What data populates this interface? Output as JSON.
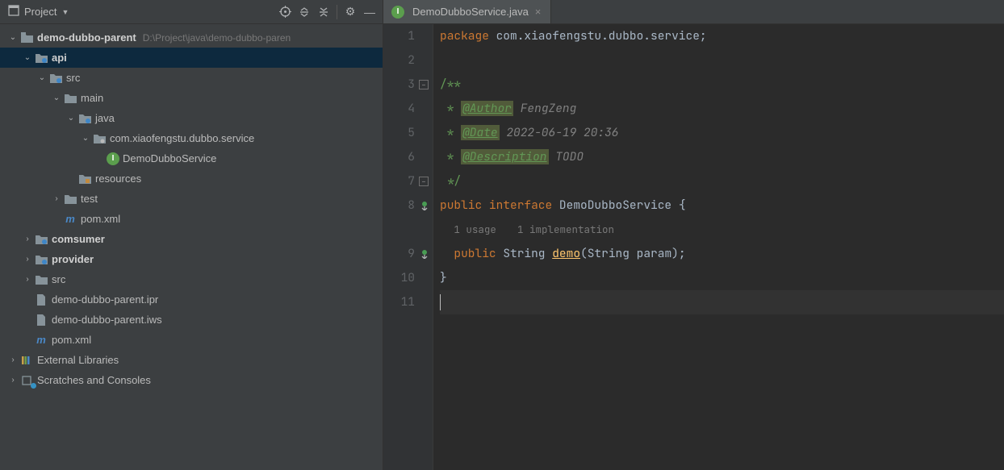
{
  "sidebar": {
    "title": "Project",
    "nodes": [
      {
        "id": "root",
        "indent": 0,
        "chev": "down",
        "icon": "folder-root",
        "label": "demo-dubbo-parent",
        "bold": true,
        "path": "D:\\Project\\java\\demo-dubbo-paren",
        "interact": true
      },
      {
        "id": "api",
        "indent": 1,
        "chev": "down",
        "icon": "folder-blue",
        "label": "api",
        "bold": true,
        "selected": true,
        "interact": true
      },
      {
        "id": "src",
        "indent": 2,
        "chev": "down",
        "icon": "folder-blue",
        "label": "src",
        "interact": true
      },
      {
        "id": "main",
        "indent": 3,
        "chev": "down",
        "icon": "folder",
        "label": "main",
        "interact": true
      },
      {
        "id": "java",
        "indent": 4,
        "chev": "down",
        "icon": "folder-blue",
        "label": "java",
        "interact": true
      },
      {
        "id": "pkg",
        "indent": 5,
        "chev": "down",
        "icon": "package",
        "label": "com.xiaofengstu.dubbo.service",
        "interact": true
      },
      {
        "id": "iface",
        "indent": 6,
        "chev": "none",
        "icon": "interface",
        "label": "DemoDubboService",
        "interact": true
      },
      {
        "id": "resources",
        "indent": 4,
        "chev": "none",
        "icon": "resources",
        "label": "resources",
        "interact": true
      },
      {
        "id": "test",
        "indent": 3,
        "chev": "right",
        "icon": "folder",
        "label": "test",
        "interact": true
      },
      {
        "id": "pom1",
        "indent": 3,
        "chev": "none",
        "icon": "maven",
        "label": "pom.xml",
        "interact": true
      },
      {
        "id": "comsumer",
        "indent": 1,
        "chev": "right",
        "icon": "folder-blue",
        "label": "comsumer",
        "bold": true,
        "interact": true
      },
      {
        "id": "provider",
        "indent": 1,
        "chev": "right",
        "icon": "folder-blue",
        "label": "provider",
        "bold": true,
        "interact": true
      },
      {
        "id": "src2",
        "indent": 1,
        "chev": "right",
        "icon": "folder",
        "label": "src",
        "interact": true
      },
      {
        "id": "ipr",
        "indent": 1,
        "chev": "none",
        "icon": "file",
        "label": "demo-dubbo-parent.ipr",
        "interact": true
      },
      {
        "id": "iws",
        "indent": 1,
        "chev": "none",
        "icon": "file",
        "label": "demo-dubbo-parent.iws",
        "interact": true
      },
      {
        "id": "pom2",
        "indent": 1,
        "chev": "none",
        "icon": "maven",
        "label": "pom.xml",
        "interact": true
      },
      {
        "id": "extlib",
        "indent": 0,
        "chev": "right",
        "icon": "libraries",
        "label": "External Libraries",
        "interact": true
      },
      {
        "id": "scratch",
        "indent": 0,
        "chev": "right",
        "icon": "scratches",
        "label": "Scratches and Consoles",
        "interact": true
      }
    ]
  },
  "tab": {
    "filename": "DemoDubboService.java"
  },
  "code": {
    "package_kw": "package",
    "package_name": "com.xiaofengstu.dubbo.service",
    "doc_open": "/**",
    "doc_author_tag": "@Author",
    "doc_author_val": "FengZeng",
    "doc_date_tag": "@Date",
    "doc_date_val": "2022-06-19 20:36",
    "doc_desc_tag": "@Description",
    "doc_desc_val": "TODO",
    "doc_close": "*/",
    "public_kw": "public",
    "interface_kw": "interface",
    "iface_name": "DemoDubboService",
    "hint_usages": "1 usage",
    "hint_impl": "1 implementation",
    "ret_type": "String",
    "method_name": "demo",
    "param_type": "String",
    "param_name": "param",
    "line_numbers": [
      "1",
      "2",
      "3",
      "4",
      "5",
      "6",
      "7",
      "8",
      "9",
      "10",
      "11"
    ]
  }
}
